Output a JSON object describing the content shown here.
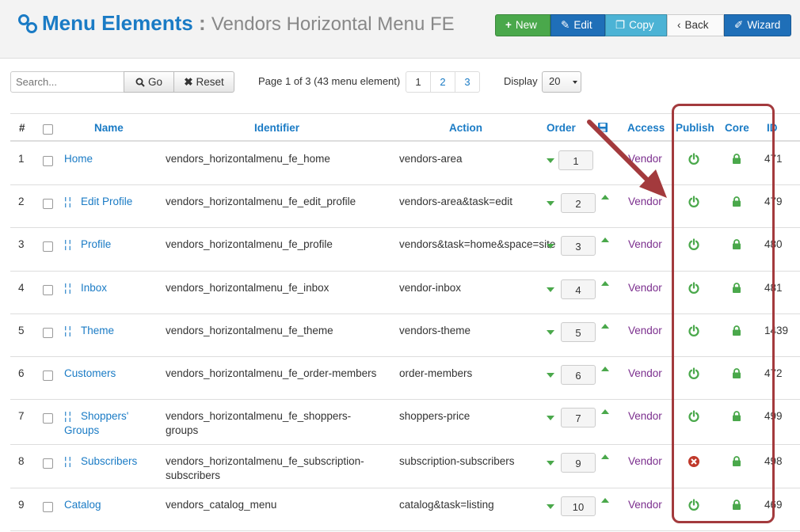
{
  "header": {
    "title": "Menu Elements",
    "separator": ":",
    "subtitle": "Vendors Horizontal Menu FE"
  },
  "toolbar": {
    "new_label": "New",
    "edit_label": "Edit",
    "copy_label": "Copy",
    "back_label": "Back",
    "wizard_label": "Wizard"
  },
  "filters": {
    "search_placeholder": "Search...",
    "go_label": "Go",
    "reset_label": "Reset",
    "page_info": "Page 1 of 3 (43 menu element)",
    "pages": [
      "1",
      "2",
      "3"
    ],
    "display_label": "Display",
    "display_value": "20"
  },
  "columns": {
    "num": "#",
    "name": "Name",
    "identifier": "Identifier",
    "action": "Action",
    "order": "Order",
    "access": "Access",
    "publish": "Publish",
    "core": "Core",
    "id": "ID"
  },
  "rows": [
    {
      "num": "1",
      "name": "Home",
      "child": false,
      "identifier": "vendors_horizontalmenu_fe_home",
      "action": "vendors-area",
      "order": "1",
      "access": "Vendor",
      "published": true,
      "id": "471"
    },
    {
      "num": "2",
      "name": "Edit Profile",
      "child": true,
      "identifier": "vendors_horizontalmenu_fe_edit_profile",
      "action": "vendors-area&task=edit",
      "order": "2",
      "access": "Vendor",
      "published": true,
      "id": "479"
    },
    {
      "num": "3",
      "name": "Profile",
      "child": true,
      "identifier": "vendors_horizontalmenu_fe_profile",
      "action": "vendors&task=home&space=site",
      "order": "3",
      "access": "Vendor",
      "published": true,
      "id": "480"
    },
    {
      "num": "4",
      "name": "Inbox",
      "child": true,
      "identifier": "vendors_horizontalmenu_fe_inbox",
      "action": "vendor-inbox",
      "order": "4",
      "access": "Vendor",
      "published": true,
      "id": "481"
    },
    {
      "num": "5",
      "name": "Theme",
      "child": true,
      "identifier": "vendors_horizontalmenu_fe_theme",
      "action": "vendors-theme",
      "order": "5",
      "access": "Vendor",
      "published": true,
      "id": "1439"
    },
    {
      "num": "6",
      "name": "Customers",
      "child": false,
      "identifier": "vendors_horizontalmenu_fe_order-members",
      "action": "order-members",
      "order": "6",
      "access": "Vendor",
      "published": true,
      "id": "472"
    },
    {
      "num": "7",
      "name": "Shoppers' Groups",
      "child": true,
      "identifier": "vendors_horizontalmenu_fe_shoppers-groups",
      "action": "shoppers-price",
      "order": "7",
      "access": "Vendor",
      "published": true,
      "id": "499"
    },
    {
      "num": "8",
      "name": "Subscribers",
      "child": true,
      "identifier": "vendors_horizontalmenu_fe_subscription-subscribers",
      "action": "subscription-subscribers",
      "order": "9",
      "access": "Vendor",
      "published": false,
      "id": "498"
    },
    {
      "num": "9",
      "name": "Catalog",
      "child": false,
      "identifier": "vendors_catalog_menu",
      "action": "catalog&task=listing",
      "order": "10",
      "access": "Vendor",
      "published": true,
      "id": "469"
    }
  ],
  "icons": {
    "logo": "link-icon",
    "publish_on": "power-icon",
    "publish_off": "x-circle-icon",
    "core": "lock-icon",
    "save_order": "floppy-disk-icon"
  },
  "colors": {
    "brand": "#1a7bc5",
    "access": "#7b2e8e",
    "published": "#4aa84b",
    "unpublished": "#c0392b",
    "annotation": "#a33a3d"
  }
}
